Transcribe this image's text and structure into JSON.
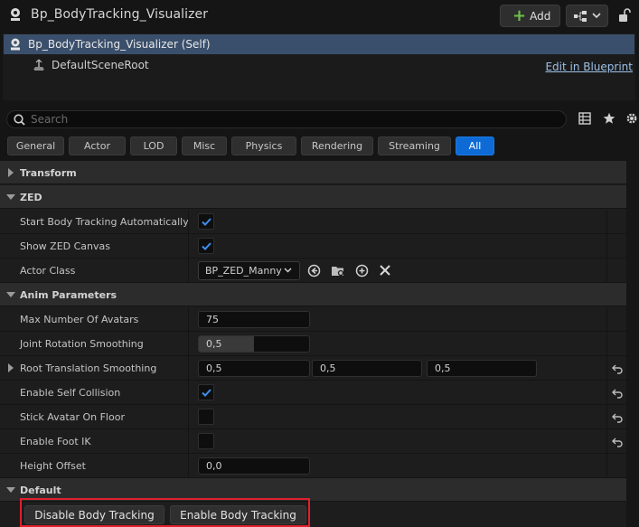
{
  "header": {
    "title": "Bp_BodyTracking_Visualizer",
    "add_label": "Add",
    "icons": {
      "actor": "actor-icon",
      "hierarchy": "hierarchy-icon",
      "lock": "lock-icon"
    }
  },
  "components": {
    "self_label": "Bp_BodyTracking_Visualizer (Self)",
    "root_label": "DefaultSceneRoot",
    "edit_link": "Edit in Blueprint"
  },
  "search": {
    "placeholder": "Search",
    "value": ""
  },
  "filters": [
    "General",
    "Actor",
    "LOD",
    "Misc",
    "Physics",
    "Rendering",
    "Streaming",
    "All"
  ],
  "active_filter": "All",
  "details": {
    "transform": "Transform",
    "zed": {
      "label": "ZED",
      "start_body_tracking": {
        "label": "Start Body Tracking Automatically",
        "checked": true
      },
      "show_zed_canvas": {
        "label": "Show ZED Canvas",
        "checked": true
      },
      "actor_class": {
        "label": "Actor Class",
        "value": "BP_ZED_Manny"
      }
    },
    "anim": {
      "label": "Anim Parameters",
      "max_avatars": {
        "label": "Max Number Of Avatars",
        "value": "75"
      },
      "joint_rotation": {
        "label": "Joint Rotation Smoothing",
        "value": "0,5",
        "fill": 0.5
      },
      "root_translation": {
        "label": "Root Translation Smoothing",
        "x": "0,5",
        "y": "0,5",
        "z": "0,5"
      },
      "self_collision": {
        "label": "Enable Self Collision",
        "checked": true
      },
      "stick_floor": {
        "label": "Stick Avatar On Floor",
        "checked": false
      },
      "foot_ik": {
        "label": "Enable Foot IK",
        "checked": false
      },
      "height_offset": {
        "label": "Height Offset",
        "value": "0,0"
      }
    },
    "default": {
      "label": "Default",
      "disable_button": "Disable Body Tracking",
      "enable_button": "Enable Body Tracking"
    }
  },
  "colors": {
    "accent": "#0e6bd6",
    "selection": "#3a4f6b",
    "highlight": "#e0202c",
    "add_plus": "#6cc24a"
  }
}
